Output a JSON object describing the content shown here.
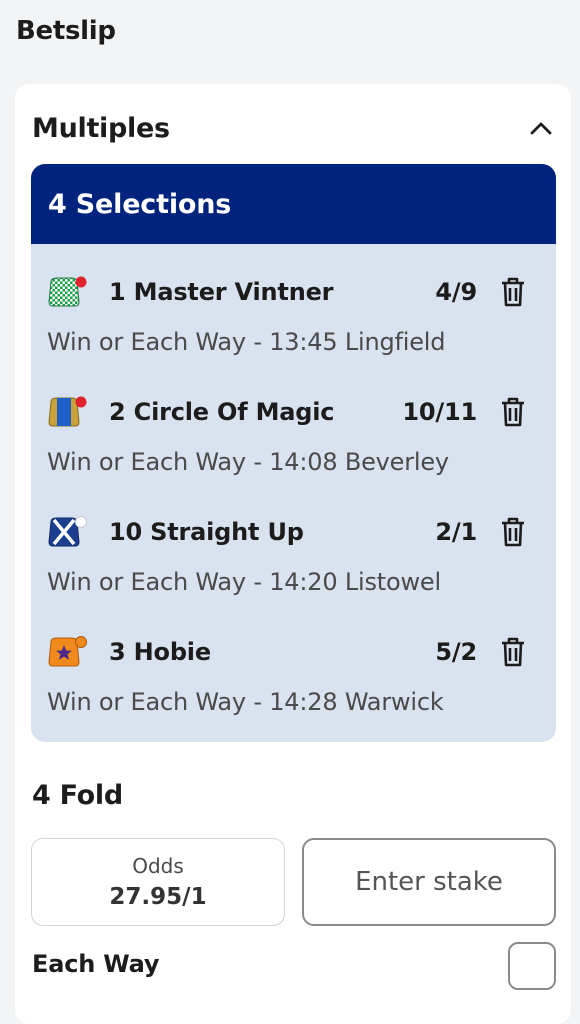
{
  "page": {
    "title": "Betslip"
  },
  "multiples": {
    "title": "Multiples",
    "selections_header": "4 Selections",
    "selections": [
      {
        "runner": "1 Master Vintner",
        "odds": "4/9",
        "description": "Win or Each Way - 13:45 Lingfield",
        "silk": "green-white-check-silk-icon",
        "cap_color": "#e0232b"
      },
      {
        "runner": "2 Circle Of Magic",
        "odds": "10/11",
        "description": "Win or Each Way - 14:08 Beverley",
        "silk": "blue-gold-silk-icon",
        "cap_color": "#e0232b"
      },
      {
        "runner": "10 Straight Up",
        "odds": "2/1",
        "description": "Win or Each Way - 14:20 Listowel",
        "silk": "navy-white-cross-silk-icon",
        "cap_color": "#ffffff"
      },
      {
        "runner": "3 Hobie",
        "odds": "5/2",
        "description": "Win or Each Way - 14:28 Warwick",
        "silk": "orange-purple-star-silk-icon",
        "cap_color": "#f08a1c"
      }
    ]
  },
  "fold": {
    "title": "4 Fold",
    "odds_label": "Odds",
    "odds_value": "27.95/1",
    "stake_placeholder": "Enter stake",
    "each_way_label": "Each Way",
    "each_way_checked": false
  },
  "colors": {
    "header_navy": "#00237d",
    "selections_bg": "#d9e2ef"
  }
}
